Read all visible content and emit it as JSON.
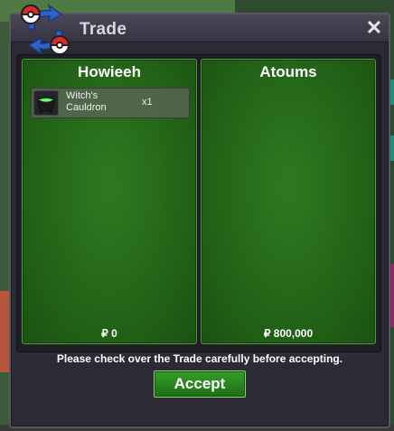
{
  "window": {
    "title": "Trade",
    "close_glyph": "✕",
    "logo_icon": "trade-arrows-pokeball-icon"
  },
  "left_panel": {
    "player_name": "Howieeh",
    "items": [
      {
        "name": "Witch's Cauldron",
        "quantity": "x1",
        "icon": "cauldron-icon"
      }
    ],
    "money": "₽ 0"
  },
  "right_panel": {
    "player_name": "Atoums",
    "items": [],
    "money": "₽ 800,000"
  },
  "notice": "Please check over the Trade carefully before accepting.",
  "accept_label": "Accept",
  "colors": {
    "panel_green": "#246518",
    "accent_green": "#35a02a",
    "window_bg": "#2c2a35"
  }
}
